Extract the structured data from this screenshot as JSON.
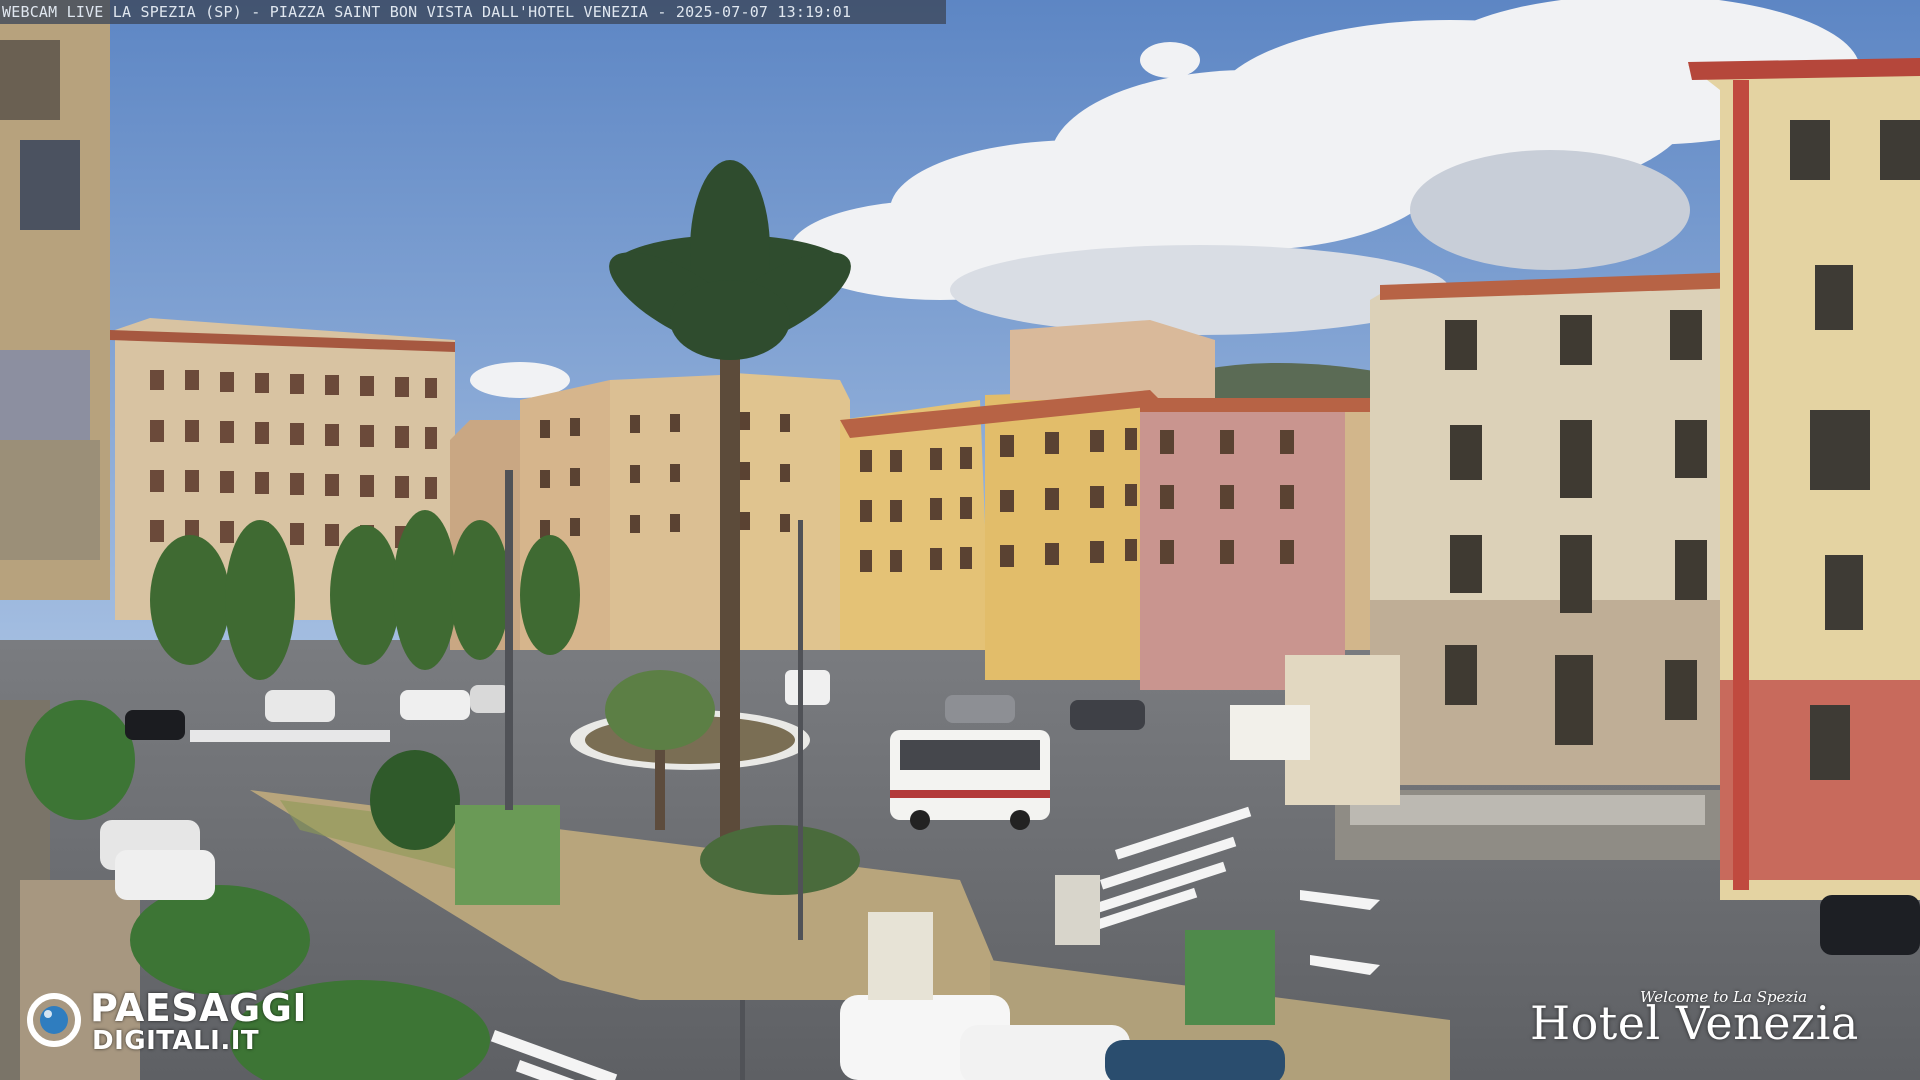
{
  "overlay": {
    "caption": "WEBCAM LIVE LA SPEZIA (SP) - PIAZZA SAINT BON VISTA DALL'HOTEL VENEZIA - 2025-07-07 13:19:01"
  },
  "logos": {
    "left": {
      "line1": "PAESAGGI",
      "line2": "DIGITALI.IT"
    },
    "right": {
      "welcome": "Welcome to La Spezia",
      "name": "Hotel Venezia"
    }
  },
  "colors": {
    "sky": "#6f97cf",
    "cloud": "#f2f3f5",
    "asphalt": "#6d6f73",
    "building_cream": "#d9c7a6",
    "building_yellow": "#e2c070",
    "building_pink": "#c99a94",
    "building_red": "#c86a5c",
    "foliage": "#3c6b2e"
  }
}
